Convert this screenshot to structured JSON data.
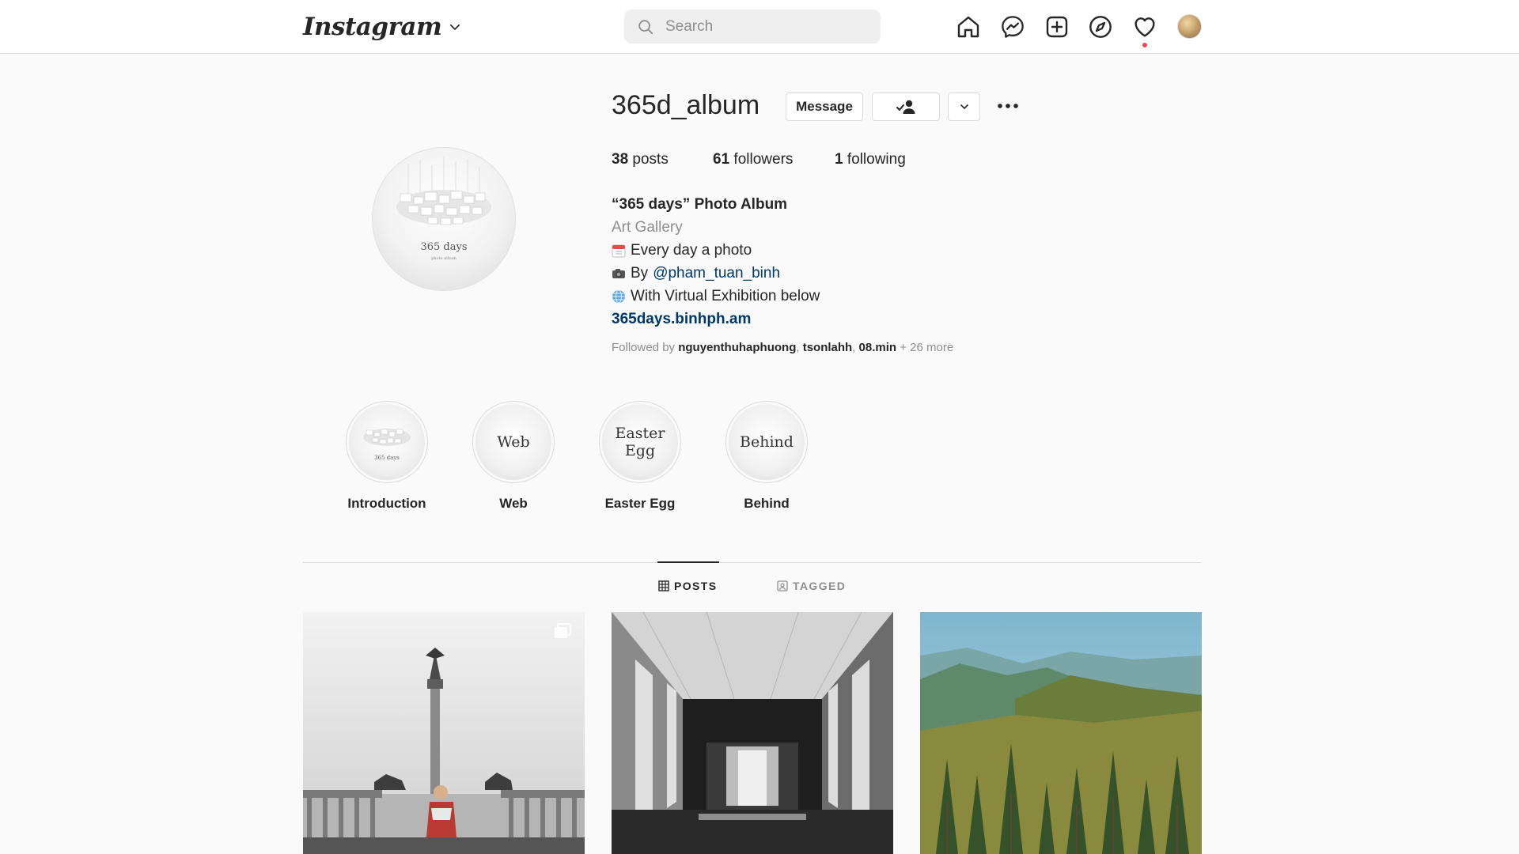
{
  "navbar": {
    "logo": "Instagram",
    "search_placeholder": "Search",
    "icons": [
      "home-icon",
      "messenger-icon",
      "new-post-icon",
      "explore-icon",
      "activity-heart-icon"
    ]
  },
  "profile": {
    "username": "365d_album",
    "message_button": "Message",
    "picture_caption": "365 days",
    "picture_subcaption": "photo album",
    "stats": {
      "posts_count": "38",
      "posts_label": "posts",
      "followers_count": "61",
      "followers_label": "followers",
      "following_count": "1",
      "following_label": "following"
    },
    "bio": {
      "name": "“365 days” Photo Album",
      "category": "Art Gallery",
      "line1": "Every day a photo",
      "line2_prefix": "By",
      "line2_mention": "@pham_tuan_binh",
      "line3": "With Virtual Exhibition below",
      "link": "365days.binhph.am"
    },
    "followed_by": {
      "prefix": "Followed by",
      "user1": "nguyenthuhaphuong",
      "sep": ",",
      "user2": "tsonlahh",
      "user3": "08.min",
      "more": "+ 26 more"
    }
  },
  "highlights": [
    {
      "label": "Introduction",
      "cover_text": "365 days"
    },
    {
      "label": "Web",
      "cover_text": "Web"
    },
    {
      "label": "Easter Egg",
      "cover_text": "Easter Egg"
    },
    {
      "label": "Behind",
      "cover_text": "Behind"
    }
  ],
  "tabs": [
    {
      "label": "POSTS",
      "active": true
    },
    {
      "label": "TAGGED",
      "active": false
    }
  ],
  "colors": {
    "link": "#00376b",
    "notification_dot": "#ed4956",
    "border": "#dbdbdb",
    "secondary_text": "#8e8e8e"
  }
}
